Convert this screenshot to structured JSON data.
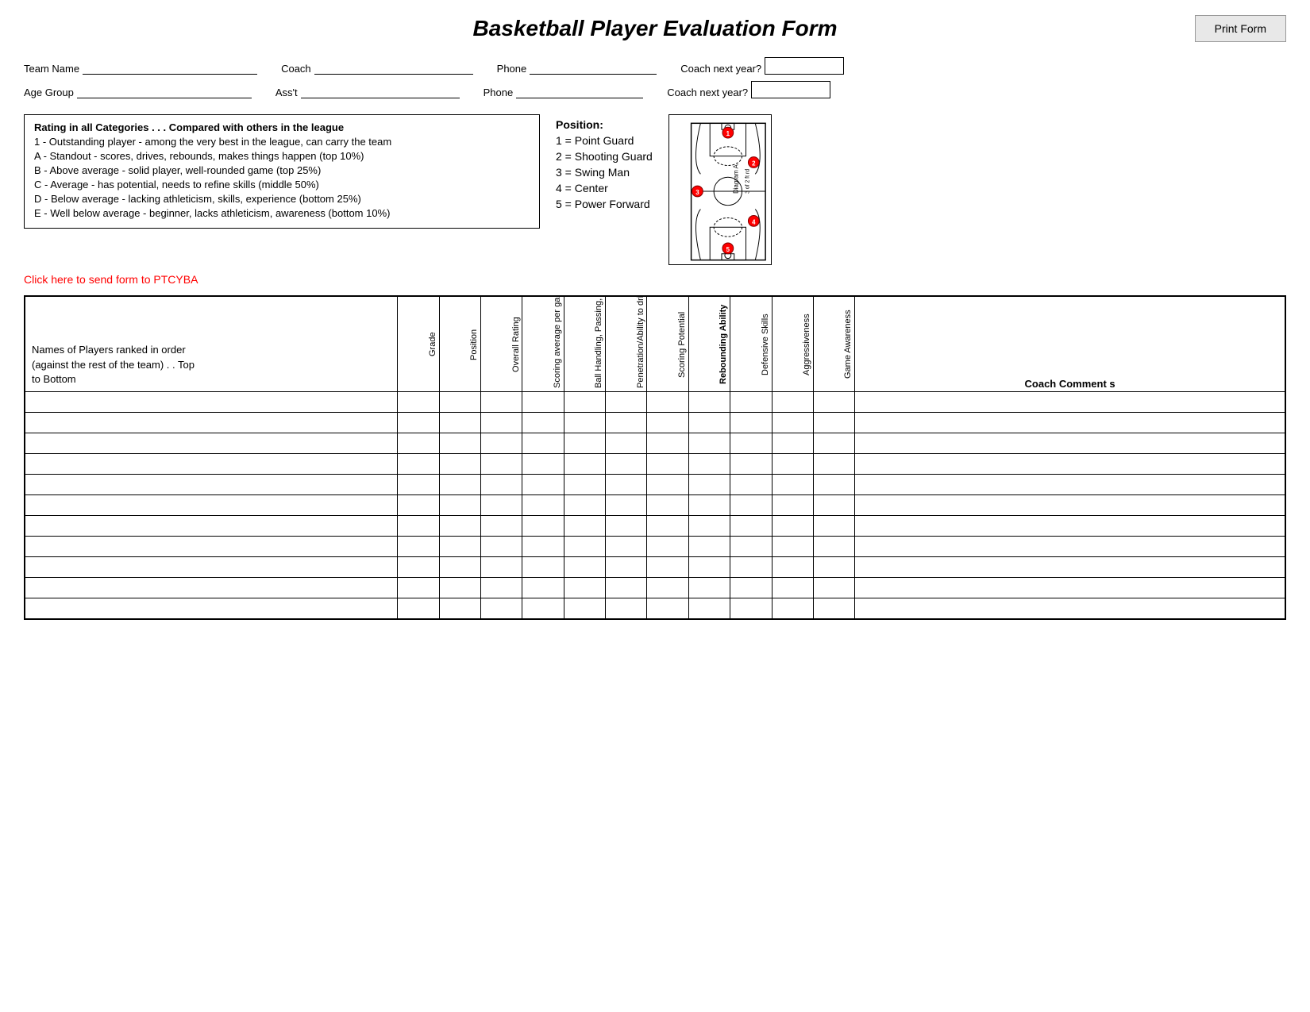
{
  "header": {
    "title": "Basketball Player Evaluation Form",
    "print_button": "Print Form"
  },
  "form": {
    "team_name_label": "Team Name",
    "coach_label": "Coach",
    "phone_label": "Phone",
    "coach_next_year_label": "Coach next year?",
    "age_group_label": "Age Group",
    "asst_label": "Ass't",
    "phone2_label": "Phone",
    "coach_next_year2_label": "Coach next year?"
  },
  "rating": {
    "title": "Rating in all Categories . . . Compared with others in the league",
    "items": [
      "1 - Outstanding player - among the very best in the league, can carry the team",
      "A - Standout - scores, drives, rebounds, makes things happen (top 10%)",
      "B - Above average - solid player, well-rounded game (top 25%)",
      "C - Average - has potential, needs to refine skills (middle 50%)",
      "D - Below average - lacking athleticism, skills, experience (bottom 25%)",
      "E - Well below average - beginner, lacks athleticism, awareness (bottom 10%)"
    ]
  },
  "position": {
    "title": "Position:",
    "items": [
      "1 = Point Guard",
      "2 = Shooting Guard",
      "3 = Swing Man",
      "4 = Center",
      "5 = Power Forward"
    ]
  },
  "click_link": "Click here to send form to PTCYBA",
  "table": {
    "name_col_header": "Names of Players ranked in order\n(against the rest of the team) . . Top\nto Bottom",
    "columns": [
      {
        "label": "Grade",
        "bold": false
      },
      {
        "label": "Position",
        "bold": false
      },
      {
        "label": "Overall Rating",
        "bold": false
      },
      {
        "label": "Scoring average per game",
        "bold": false
      },
      {
        "label": "Ball Handling, Passing, Dribbling",
        "bold": false
      },
      {
        "label": "Penetration/Ability to drive to the hoop",
        "bold": false
      },
      {
        "label": "Scoring Potential",
        "bold": false
      },
      {
        "label": "Rebounding Ability",
        "bold": true
      },
      {
        "label": "Defensive Skills",
        "bold": false
      },
      {
        "label": "Aggressiveness",
        "bold": false
      },
      {
        "label": "Game Awareness",
        "bold": false
      }
    ],
    "comments_col": "Coach Comment s",
    "num_rows": 11
  },
  "court": {
    "diagram_label": "Diagram A",
    "label_3pt": "3 of 2 ft rd"
  }
}
